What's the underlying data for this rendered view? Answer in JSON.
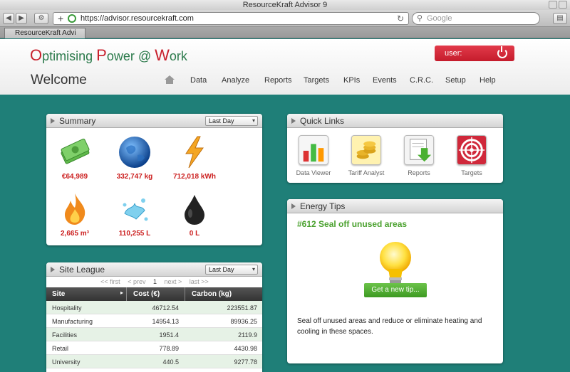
{
  "browser": {
    "window_title": "ResourceKraft Advisor 9",
    "url": "https://advisor.resourcekraft.com",
    "search_placeholder": "Google",
    "tab_title": "ResourceKraft Advi"
  },
  "app": {
    "logo": {
      "p1_cap": "O",
      "p1": "ptimising ",
      "p2_cap": "P",
      "p2": "ower @ ",
      "p3_cap": "W",
      "p3": "ork"
    },
    "user_label": "user:",
    "welcome": "Welcome",
    "nav": [
      "Data",
      "Analyze",
      "Reports",
      "Targets",
      "KPIs",
      "Events",
      "C.R.C.",
      "Setup",
      "Help"
    ]
  },
  "summary": {
    "title": "Summary",
    "period": "Last Day",
    "items": [
      {
        "icon": "money-icon",
        "value": "€64,989"
      },
      {
        "icon": "globe-icon",
        "value": "332,747 kg"
      },
      {
        "icon": "lightning-icon",
        "value": "712,018 kWh"
      },
      {
        "icon": "flame-icon",
        "value": "2,665 m³"
      },
      {
        "icon": "water-splash-icon",
        "value": "110,255 L"
      },
      {
        "icon": "oil-drop-icon",
        "value": "0 L"
      }
    ]
  },
  "quick_links": {
    "title": "Quick Links",
    "items": [
      {
        "icon": "bar-chart-icon",
        "label": "Data Viewer"
      },
      {
        "icon": "coins-icon",
        "label": "Tariff Analyst"
      },
      {
        "icon": "report-download-icon",
        "label": "Reports"
      },
      {
        "icon": "target-icon",
        "label": "Targets"
      }
    ]
  },
  "energy_tips": {
    "title": "Energy Tips",
    "tip_title": "#612 Seal off unused areas",
    "button": "Get a new tip...",
    "text": "Seal off unused areas and reduce or eliminate heating and cooling in these spaces."
  },
  "site_league": {
    "title": "Site League",
    "period": "Last Day",
    "pager": {
      "first": "<< first",
      "prev": "< prev",
      "page": "1",
      "next": "next >",
      "last": "last >>"
    },
    "columns": [
      "Site",
      "Cost (€)",
      "Carbon (kg)"
    ],
    "rows": [
      {
        "site": "Hospitality",
        "cost": "46712.54",
        "carbon": "223551.87"
      },
      {
        "site": "Manufacturing",
        "cost": "14954.13",
        "carbon": "89936.25"
      },
      {
        "site": "Facilities",
        "cost": "1951.4",
        "carbon": "2119.9"
      },
      {
        "site": "Retail",
        "cost": "778.89",
        "carbon": "4430.98"
      },
      {
        "site": "University",
        "cost": "440.5",
        "carbon": "9277.78"
      }
    ]
  },
  "colors": {
    "brand_green": "#2b7a4b",
    "accent_red": "#c8202c",
    "background_teal": "#1f7f78",
    "tip_green": "#4aa12e"
  }
}
